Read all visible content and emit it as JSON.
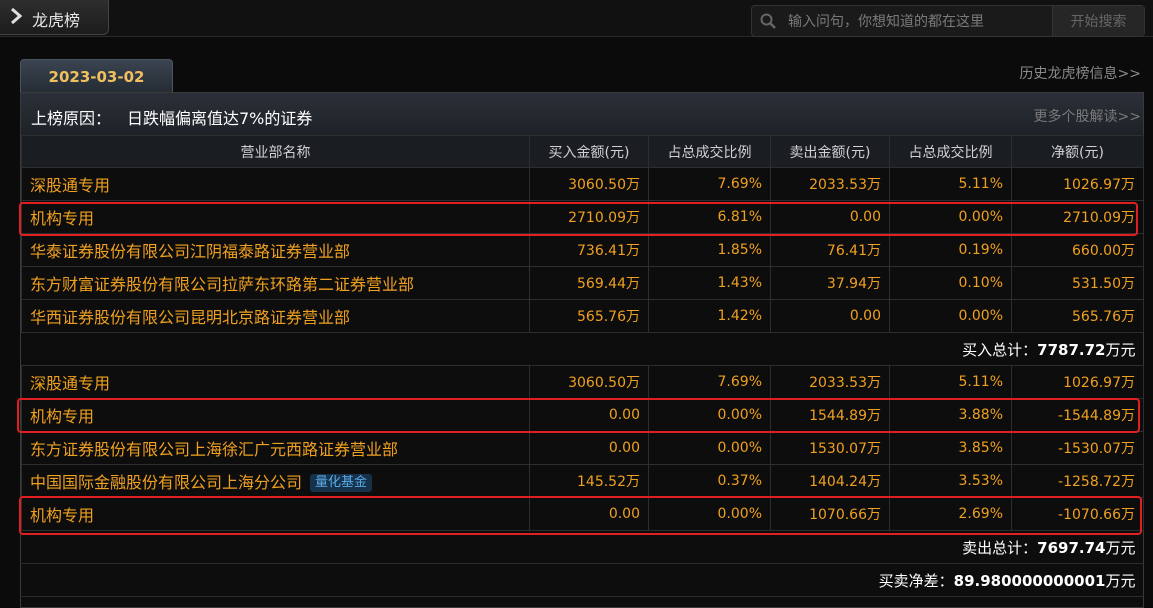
{
  "header": {
    "title": "龙虎榜",
    "search_placeholder": "输入问句，你想知道的都在这里",
    "search_button": "开始搜索"
  },
  "date_tab": "2023-03-02",
  "history_link": "历史龙虎榜信息>>",
  "reason": {
    "label": "上榜原因：",
    "text": "日跌幅偏离值达7%的证券"
  },
  "more_link": "更多个股解读>>",
  "columns": [
    "营业部名称",
    "买入金额(元)",
    "占总成交比例",
    "卖出金额(元)",
    "占总成交比例",
    "净额(元)"
  ],
  "buy_rows": [
    {
      "name": "深股通专用",
      "buy": "3060.50万",
      "buy_pct": "7.69%",
      "sell": "2033.53万",
      "sell_pct": "5.11%",
      "net": "1026.97万"
    },
    {
      "name": "机构专用",
      "buy": "2710.09万",
      "buy_pct": "6.81%",
      "sell": "0.00",
      "sell_pct": "0.00%",
      "net": "2710.09万"
    },
    {
      "name": "华泰证券股份有限公司江阴福泰路证券营业部",
      "buy": "736.41万",
      "buy_pct": "1.85%",
      "sell": "76.41万",
      "sell_pct": "0.19%",
      "net": "660.00万"
    },
    {
      "name": "东方财富证券股份有限公司拉萨东环路第二证券营业部",
      "buy": "569.44万",
      "buy_pct": "1.43%",
      "sell": "37.94万",
      "sell_pct": "0.10%",
      "net": "531.50万"
    },
    {
      "name": "华西证券股份有限公司昆明北京路证券营业部",
      "buy": "565.76万",
      "buy_pct": "1.42%",
      "sell": "0.00",
      "sell_pct": "0.00%",
      "net": "565.76万"
    }
  ],
  "buy_total": {
    "label": "买入总计：",
    "value": "7787.72",
    "unit": "万元"
  },
  "sell_rows": [
    {
      "name": "深股通专用",
      "buy": "3060.50万",
      "buy_pct": "7.69%",
      "sell": "2033.53万",
      "sell_pct": "5.11%",
      "net": "1026.97万"
    },
    {
      "name": "机构专用",
      "buy": "0.00",
      "buy_pct": "0.00%",
      "sell": "1544.89万",
      "sell_pct": "3.88%",
      "net": "-1544.89万"
    },
    {
      "name": "东方证券股份有限公司上海徐汇广元西路证券营业部",
      "buy": "0.00",
      "buy_pct": "0.00%",
      "sell": "1530.07万",
      "sell_pct": "3.85%",
      "net": "-1530.07万"
    },
    {
      "name": "中国国际金融股份有限公司上海分公司",
      "badge": "量化基金",
      "buy": "145.52万",
      "buy_pct": "0.37%",
      "sell": "1404.24万",
      "sell_pct": "3.53%",
      "net": "-1258.72万"
    },
    {
      "name": "机构专用",
      "buy": "0.00",
      "buy_pct": "0.00%",
      "sell": "1070.66万",
      "sell_pct": "2.69%",
      "net": "-1070.66万"
    }
  ],
  "sell_total": {
    "label": "卖出总计：",
    "value": "7697.74",
    "unit": "万元"
  },
  "net_total": {
    "label": "买卖净差：",
    "value": "89.980000000001",
    "unit": "万元"
  },
  "colors": {
    "accent": "#f0a020",
    "highlight": "#e02020",
    "badge": "#5aa8e6"
  }
}
